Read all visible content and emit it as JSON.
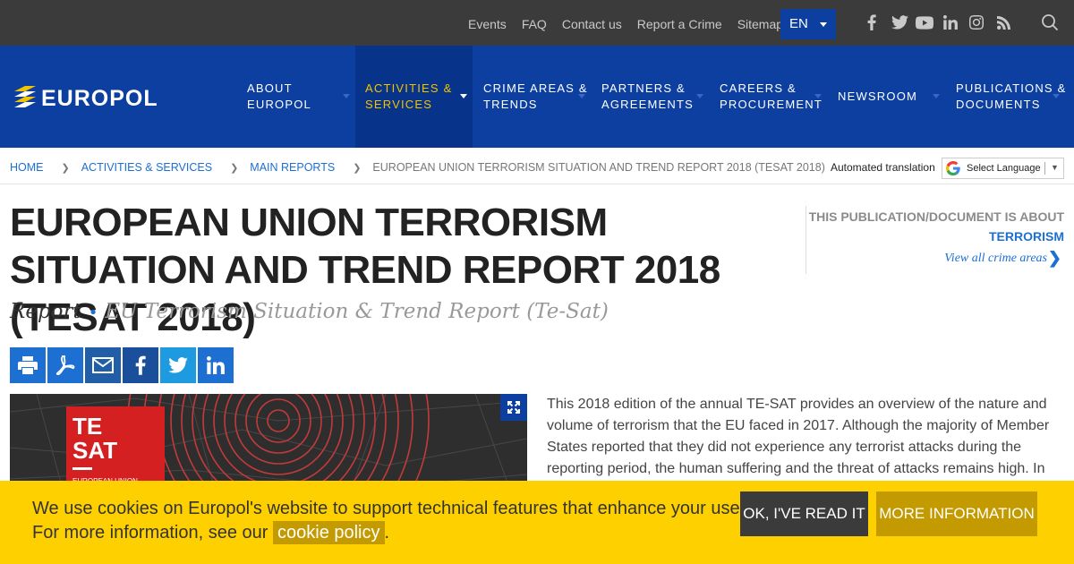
{
  "topbar": {
    "links": [
      "Events",
      "FAQ",
      "Contact us",
      "Report a Crime",
      "Sitemap"
    ],
    "language": "EN",
    "social_icons": [
      "facebook-icon",
      "twitter-icon",
      "youtube-icon",
      "linkedin-icon",
      "instagram-icon",
      "rss-icon"
    ],
    "search_icon": "search-icon"
  },
  "nav": {
    "logo_text": "EUROPOL",
    "items": [
      {
        "label": "About Europol",
        "lines": [
          "About Europol"
        ]
      },
      {
        "label": "Activities & Services",
        "lines": [
          "Activities &",
          "Services"
        ],
        "active": true
      },
      {
        "label": "Crime Areas & Trends",
        "lines": [
          "Crime Areas &",
          "Trends"
        ]
      },
      {
        "label": "Partners & Agreements",
        "lines": [
          "Partners &",
          "Agreements"
        ]
      },
      {
        "label": "Careers & Procurement",
        "lines": [
          "Careers &",
          "Procurement"
        ]
      },
      {
        "label": "Newsroom",
        "lines": [
          "Newsroom"
        ]
      },
      {
        "label": "Publications & Documents",
        "lines": [
          "Publications &",
          "Documents"
        ]
      }
    ]
  },
  "breadcrumb": {
    "items": [
      "Home",
      "Activities & Services",
      "Main Reports"
    ],
    "current": "European Union Terrorism Situation and Trend Report 2018 (TESAT 2018)"
  },
  "translate": {
    "label": "Automated translation",
    "select": "Select Language"
  },
  "page": {
    "title": "European Union Terrorism Situation and Trend Report 2018 (TESAT 2018)",
    "type": "Report",
    "series": "EU Terrorism Situation & Trend Report (Te-Sat)"
  },
  "aside": {
    "about_label": "This publication/document is about",
    "topic": "Terrorism",
    "view_all": "View all crime areas"
  },
  "share": {
    "icons": [
      "print-icon",
      "pdf-icon",
      "email-icon",
      "facebook-icon",
      "twitter-icon",
      "linkedin-icon"
    ],
    "colors": [
      "#1d6fd1",
      "#1d6fd1",
      "#215ea8",
      "#1a4f9c",
      "#1d9ae0",
      "#1d6fd1"
    ]
  },
  "cover": {
    "brand_line1": "TE",
    "brand_line2": "SAT",
    "brand_line3": "EUROPEAN UNION"
  },
  "body": {
    "text": "This 2018 edition of the annual TE-SAT provides an overview of the nature and volume of terrorism that the EU faced in 2017. Although the majority of Member States reported that they did not experience any terrorist attacks during the reporting period, the human suffering and the threat of attacks remains high. In"
  },
  "cookie": {
    "line1": "We use cookies on Europol's website to support technical features that enhance your user experience.",
    "line2_prefix": "For more information, see our",
    "policy_link": "cookie policy",
    "line2_suffix": ".",
    "ok_button": "OK, I've read it",
    "more_button": "More information"
  },
  "colors": {
    "topbar": "#3b3b3b",
    "nav": "#0c3fa0",
    "nav_active_text": "#f2c400",
    "link": "#1d6fd1",
    "cookie_bg": "#ffd000",
    "cookie_accent": "#c39b00"
  }
}
